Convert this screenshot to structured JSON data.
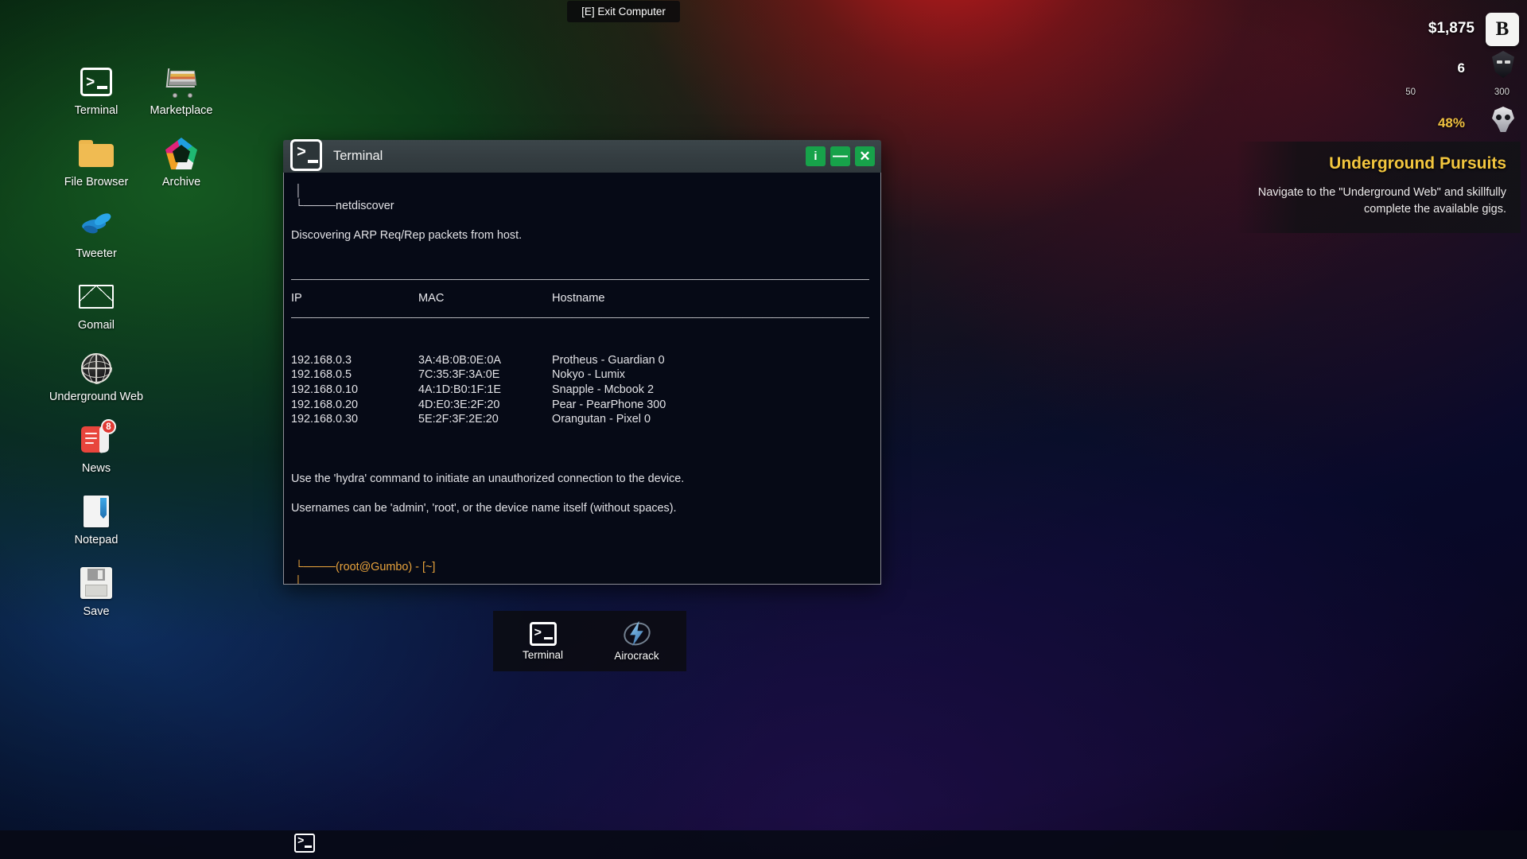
{
  "exit_button": {
    "label": "[E] Exit Computer"
  },
  "hud": {
    "money": "$1,875",
    "reputation": "6",
    "scale_min": "50",
    "scale_max": "300",
    "heat_percent": "48%",
    "brand_logo": "B",
    "accent_gold": "#f3c63e",
    "accent_green": "#17a24a"
  },
  "mission": {
    "title": "Underground Pursuits",
    "description": "Navigate to the \"Underground Web\" and skillfully complete the available gigs."
  },
  "desktop_icons": [
    {
      "label": "Terminal",
      "icon": "terminal-icon"
    },
    {
      "label": "Marketplace",
      "icon": "shopping-cart-icon"
    },
    {
      "label": "File Browser",
      "icon": "folder-icon"
    },
    {
      "label": "Archive",
      "icon": "pentagon-archive-icon"
    },
    {
      "label": "Tweeter",
      "icon": "bird-icon"
    },
    {
      "label": "Gomail",
      "icon": "envelope-icon"
    },
    {
      "label": "Underground Web",
      "icon": "globe-icon"
    },
    {
      "label": "News",
      "icon": "newspaper-icon",
      "badge": "8"
    },
    {
      "label": "Notepad",
      "icon": "notepad-icon"
    },
    {
      "label": "Save",
      "icon": "floppy-disk-icon"
    }
  ],
  "terminal": {
    "title": "Terminal",
    "buttons": {
      "info": "i",
      "minimize": "—",
      "close": "✕"
    },
    "tree_branch": "└────",
    "tree_stem": "│",
    "command": "netdiscover",
    "status_line": "Discovering ARP Req/Rep packets from host.",
    "rule": "———————————————————————————————————————————————————————————————————————————",
    "columns": {
      "ip": "IP",
      "mac": "MAC",
      "hostname": "Hostname"
    },
    "devices": [
      {
        "ip": "192.168.0.3",
        "mac": "3A:4B:0B:0E:0A",
        "hostname": "Protheus - Guardian 0"
      },
      {
        "ip": "192.168.0.5",
        "mac": "7C:35:3F:3A:0E",
        "hostname": "Nokyo - Lumix"
      },
      {
        "ip": "192.168.0.10",
        "mac": "4A:1D:B0:1F:1E",
        "hostname": "Snapple - Mcbook 2"
      },
      {
        "ip": "192.168.0.20",
        "mac": "4D:E0:3E:2F:20",
        "hostname": "Pear - PearPhone 300"
      },
      {
        "ip": "192.168.0.30",
        "mac": "5E:2F:3F:2E:20",
        "hostname": "Orangutan - Pixel 0"
      }
    ],
    "hint_hydra": "Use the 'hydra' command to initiate an unauthorized connection to the device.",
    "hint_usernames": "Usernames can be 'admin', 'root', or the device name itself (without spaces).",
    "prompt": "(root@Gumbo) - [~]",
    "prompt_color": "#e8a33c"
  },
  "taskbar": [
    {
      "label": "Terminal",
      "icon": "terminal-icon"
    },
    {
      "label": "Airocrack",
      "icon": "lightning-bolt-icon"
    }
  ]
}
